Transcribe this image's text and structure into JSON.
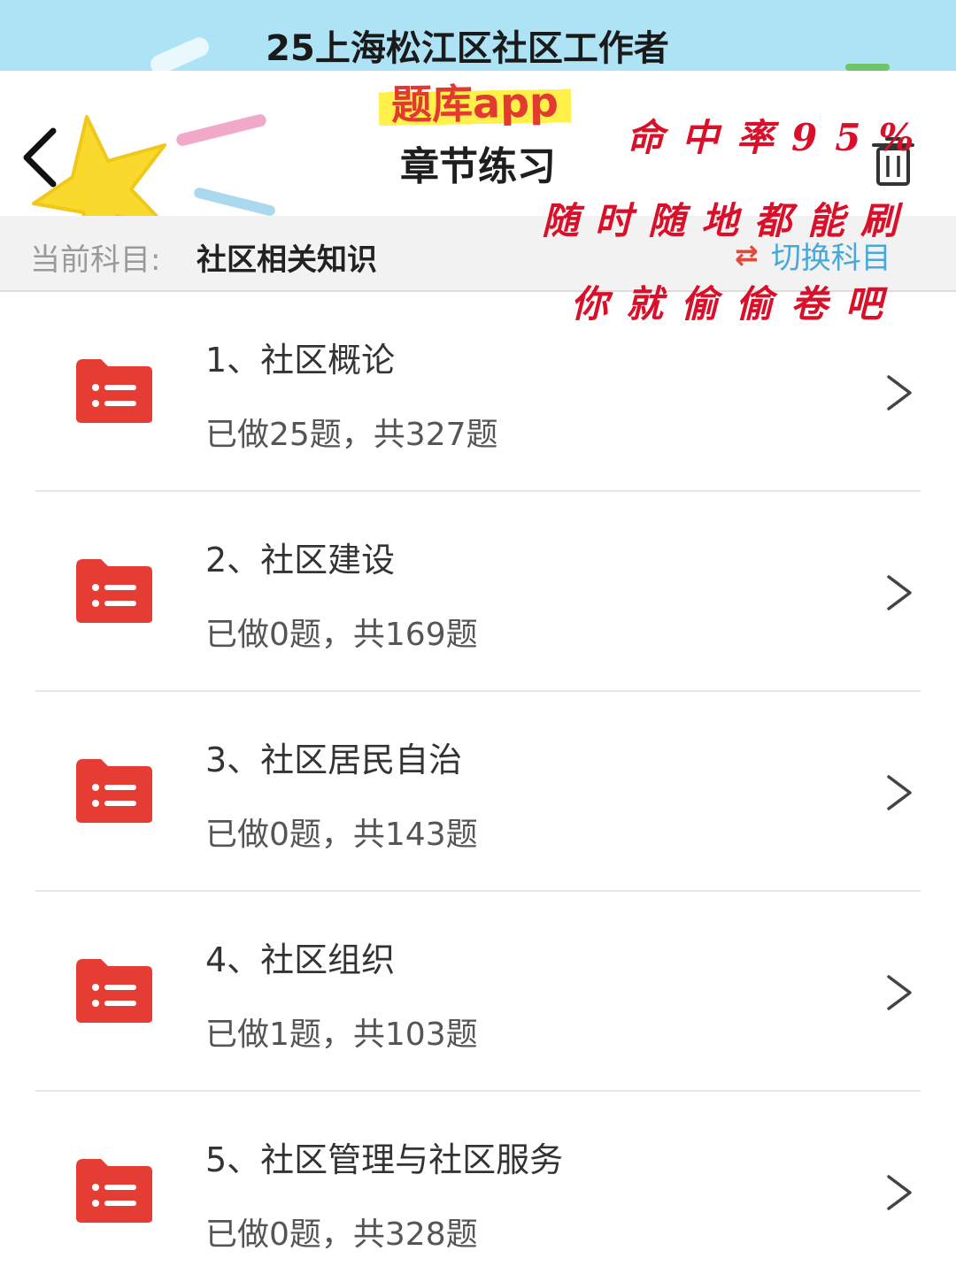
{
  "banner": {
    "title": "25上海松江区社区工作者"
  },
  "header": {
    "app_label": "题库app",
    "title": "章节练习",
    "back_icon": "chevron-left-icon",
    "trash_icon": "trash-icon"
  },
  "annotations": {
    "line1": "命中率95%",
    "line2": "随时随地都能刷",
    "line3": "你就偷偷卷吧"
  },
  "subject": {
    "label": "当前科目:",
    "value": "社区相关知识",
    "switch_label": "切换科目",
    "switch_icon": "⇄"
  },
  "chapters": [
    {
      "title": "1、社区概论",
      "progress": "已做25题，共327题"
    },
    {
      "title": "2、社区建设",
      "progress": "已做0题，共169题"
    },
    {
      "title": "3、社区居民自治",
      "progress": "已做0题，共143题"
    },
    {
      "title": "4、社区组织",
      "progress": "已做1题，共103题"
    },
    {
      "title": "5、社区管理与社区服务",
      "progress": "已做0题，共328题"
    }
  ],
  "colors": {
    "banner_bg": "#aee3f6",
    "accent_red": "#e23a31",
    "switch_blue": "#4aa8d8",
    "highlight_yellow": "#fff04a"
  }
}
